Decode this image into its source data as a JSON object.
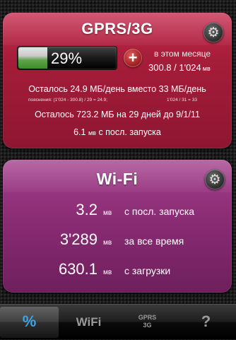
{
  "gprs": {
    "title": "GPRS/3G",
    "usage_percent_label": "29%",
    "usage_fraction": 0.29,
    "month_label": "в этом месяце",
    "month_value": "300.8 / 1'024",
    "month_unit": "мв",
    "remaining_daily": "Осталось 24.9 МБ/день вместо 33 МБ/день",
    "explain_left": "пояснения: (1'024 - 300.8) / 29 = 24.9;",
    "explain_right": "1'024 / 31 = 33",
    "remaining_total": "Осталось 723.2 МБ на 29 дней до 9/1/11",
    "since_launch_value": "6.1",
    "since_launch_unit": "мв",
    "since_launch_label": "с посл. запуска"
  },
  "wifi": {
    "title": "Wi-Fi",
    "rows": [
      {
        "value": "3.2",
        "unit": "мв",
        "label": "с посл. запуска"
      },
      {
        "value": "3'289",
        "unit": "мв",
        "label": "за все время"
      },
      {
        "value": "630.1",
        "unit": "мв",
        "label": "с загрузки"
      }
    ]
  },
  "tabs": [
    {
      "label": "%"
    },
    {
      "label": "WiFi"
    },
    {
      "label_line1": "GPRS",
      "label_line2": "3G"
    },
    {
      "label": "?"
    }
  ],
  "icons": {
    "settings": "gear-icon",
    "add": "plus-icon"
  },
  "colors": {
    "gprs_card": "#a51d39",
    "wifi_card": "#8a2c74",
    "active_tab_glyph": "#3aa8e8",
    "meter_green": "#3f8e2a"
  }
}
